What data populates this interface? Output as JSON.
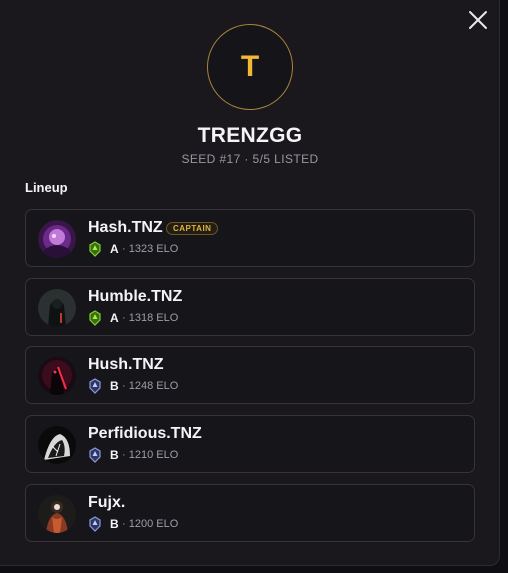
{
  "team": {
    "initial": "T",
    "name": "TRENZGG",
    "meta": "SEED #17 · 5/5 LISTED"
  },
  "lineup_title": "Lineup",
  "captain_label": "CAPTAIN",
  "colors": {
    "accent_gold": "#f2b735",
    "tier_a": "#7bd12a",
    "tier_b": "#8a9bd8"
  },
  "players": [
    {
      "name": "Hash.TNZ",
      "tier": "A",
      "elo": "· 1323 ELO",
      "captain": true
    },
    {
      "name": "Humble.TNZ",
      "tier": "A",
      "elo": "· 1318 ELO",
      "captain": false
    },
    {
      "name": "Hush.TNZ",
      "tier": "B",
      "elo": "· 1248 ELO",
      "captain": false
    },
    {
      "name": "Perfidious.TNZ",
      "tier": "B",
      "elo": "· 1210 ELO",
      "captain": false
    },
    {
      "name": "Fujx.",
      "tier": "B",
      "elo": "· 1200 ELO",
      "captain": false
    }
  ]
}
